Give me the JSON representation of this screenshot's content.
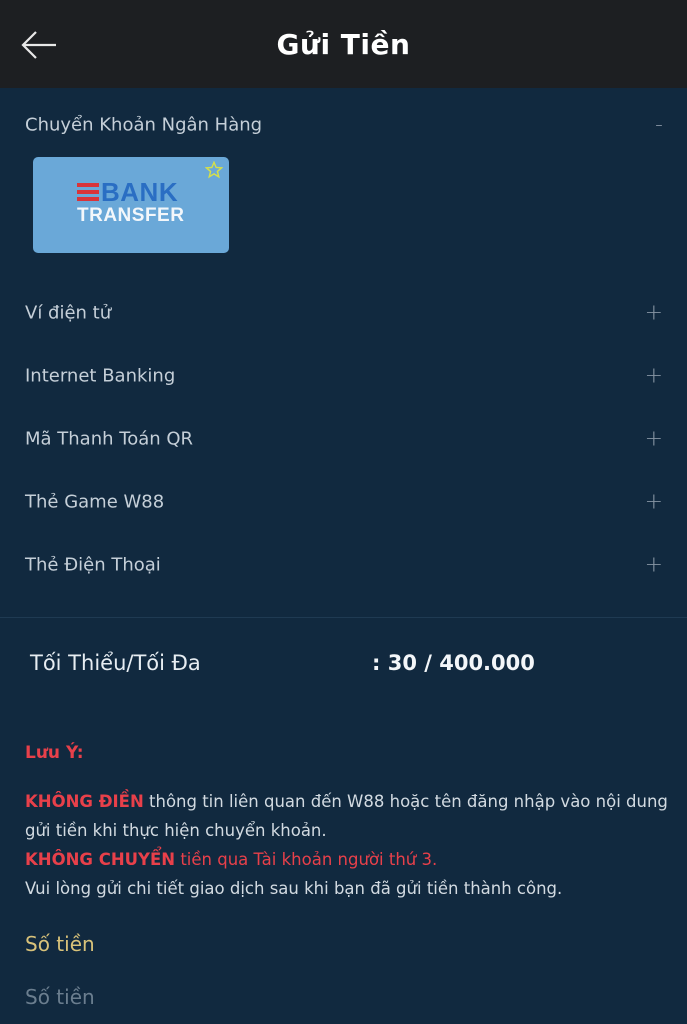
{
  "header": {
    "title": "Gửi Tiền",
    "back_icon": "arrow-left-icon"
  },
  "payment_methods": [
    {
      "label": "Chuyển Khoản Ngân Hàng",
      "toggle": "-",
      "expanded": true
    },
    {
      "label": "Ví điện tử",
      "toggle": "+",
      "expanded": false
    },
    {
      "label": "Internet Banking",
      "toggle": "+",
      "expanded": false
    },
    {
      "label": "Mã Thanh Toán QR",
      "toggle": "+",
      "expanded": false
    },
    {
      "label": "Thẻ Game W88",
      "toggle": "+",
      "expanded": false
    },
    {
      "label": "Thẻ Điện Thoại",
      "toggle": "+",
      "expanded": false
    }
  ],
  "bank_option": {
    "logo_word_1": "BANK",
    "logo_word_2": "TRANSFER",
    "favorite_icon": "star-icon",
    "card_color": "#6aa8d8"
  },
  "limits": {
    "label": "Tối Thiểu/Tối Đa",
    "value": ": 30 / 400.000"
  },
  "note": {
    "title": "Lưu Ý:",
    "line1_bold": "KHÔNG ĐIỀN",
    "line1_rest": " thông tin liên quan đến W88 hoặc tên đăng nhập vào nội dung gửi tiền khi thực hiện chuyển khoản.",
    "line2_bold": "KHÔNG CHUYỂN",
    "line2_rest": " tiền qua Tài khoản người thứ 3.",
    "line3": "Vui lòng gửi chi tiết giao dịch sau khi bạn đã gửi tiền thành công."
  },
  "amount": {
    "label": "Số tiền",
    "placeholder": "Số tiền",
    "value": ""
  },
  "colors": {
    "background": "#11293f",
    "header": "#1d1f22",
    "warning": "#e8404a",
    "amount_label": "#d8c27a"
  }
}
